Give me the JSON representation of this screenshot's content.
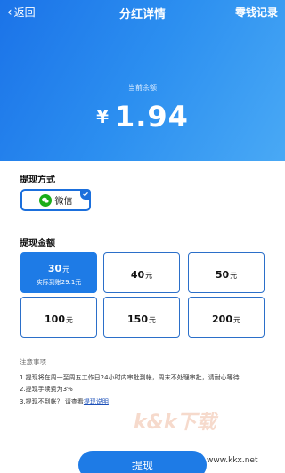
{
  "nav": {
    "back_label": "返回",
    "title": "分红详情",
    "right_label": "零钱记录"
  },
  "balance": {
    "label": "当前余额",
    "currency": "¥",
    "amount": "1.94"
  },
  "pay_method": {
    "section_title": "提现方式",
    "selected": "微信",
    "icon": "wechat-icon",
    "wechat_color": "#1aad19"
  },
  "amounts": {
    "section_title": "提现金额",
    "unit": "元",
    "options": [
      {
        "value": "30",
        "sub": "实际到账29.1元",
        "selected": true
      },
      {
        "value": "40"
      },
      {
        "value": "50"
      },
      {
        "value": "100"
      },
      {
        "value": "150"
      },
      {
        "value": "200"
      }
    ]
  },
  "notes": {
    "title": "注意事项",
    "items": [
      "1.提现将在周一至周五工作日24小时内审批到帐，周末不处理审批，请耐心等待",
      "2.提现手续费为3%"
    ],
    "item3_prefix": "3.提现不到帐？ 请查看",
    "item3_link": "提现说明"
  },
  "submit_label": "提现",
  "watermark": {
    "text": "k&k下载",
    "url": "www.kkx.net"
  },
  "colors": {
    "accent": "#1e7be6",
    "header_gradient_start": "#1b73e8",
    "header_gradient_end": "#49a9f5",
    "selected_border": "#1b6fdc"
  }
}
